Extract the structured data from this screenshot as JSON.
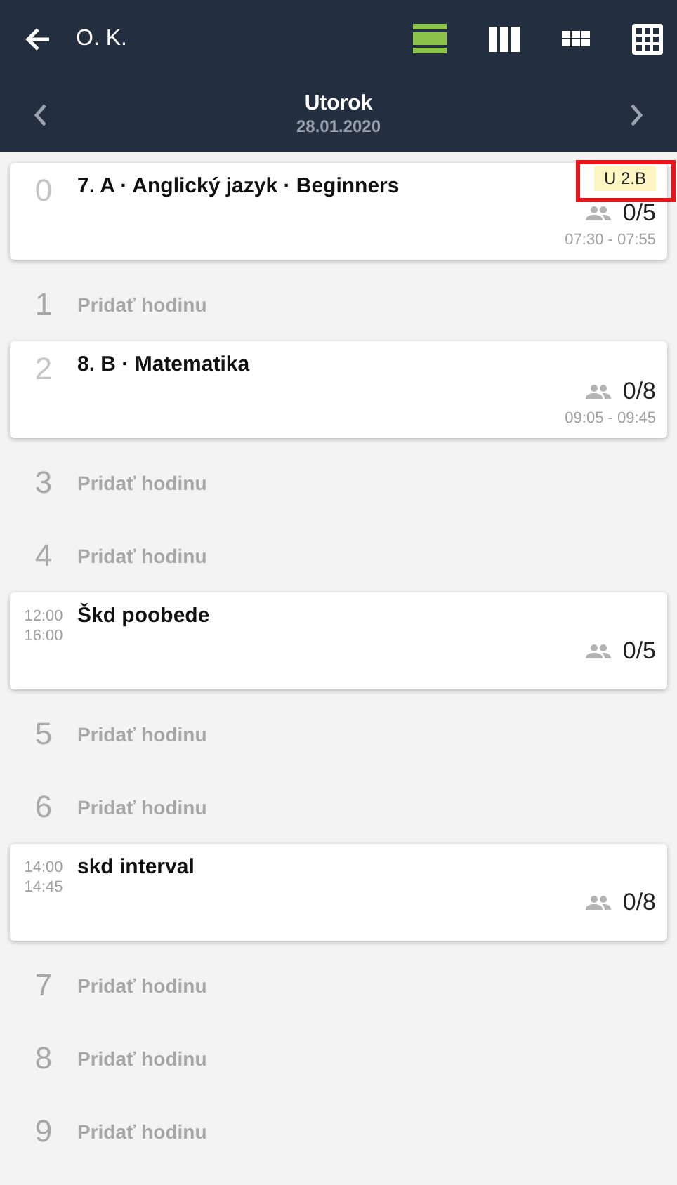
{
  "header": {
    "title": "O. K.",
    "view_modes": [
      {
        "kind": "day",
        "selected": true
      },
      {
        "kind": "columns",
        "selected": false
      },
      {
        "kind": "grid",
        "selected": false
      },
      {
        "kind": "month",
        "selected": false
      }
    ]
  },
  "day_nav": {
    "day": "Utorok",
    "date": "28.01.2020"
  },
  "rows": [
    {
      "kind": "lesson",
      "number": "0",
      "title": "7. A · Anglický jazyk · Beginners",
      "room": "U 2.B",
      "room_highlighted": true,
      "count": "0/5",
      "time": "07:30 - 07:55"
    },
    {
      "kind": "empty",
      "number": "1",
      "label": "Pridať hodinu"
    },
    {
      "kind": "lesson",
      "number": "2",
      "title": "8. B · Matematika",
      "count": "0/8",
      "time": "09:05 - 09:45"
    },
    {
      "kind": "empty",
      "number": "3",
      "label": "Pridať hodinu"
    },
    {
      "kind": "empty",
      "number": "4",
      "label": "Pridať hodinu"
    },
    {
      "kind": "interval",
      "start": "12:00",
      "end": "16:00",
      "title": "Škd poobede",
      "count": "0/5"
    },
    {
      "kind": "empty",
      "number": "5",
      "label": "Pridať hodinu"
    },
    {
      "kind": "empty",
      "number": "6",
      "label": "Pridať hodinu"
    },
    {
      "kind": "interval",
      "start": "14:00",
      "end": "14:45",
      "title": "skd interval",
      "count": "0/8"
    },
    {
      "kind": "empty",
      "number": "7",
      "label": "Pridať hodinu"
    },
    {
      "kind": "empty",
      "number": "8",
      "label": "Pridať hodinu"
    },
    {
      "kind": "empty",
      "number": "9",
      "label": "Pridať hodinu"
    }
  ]
}
